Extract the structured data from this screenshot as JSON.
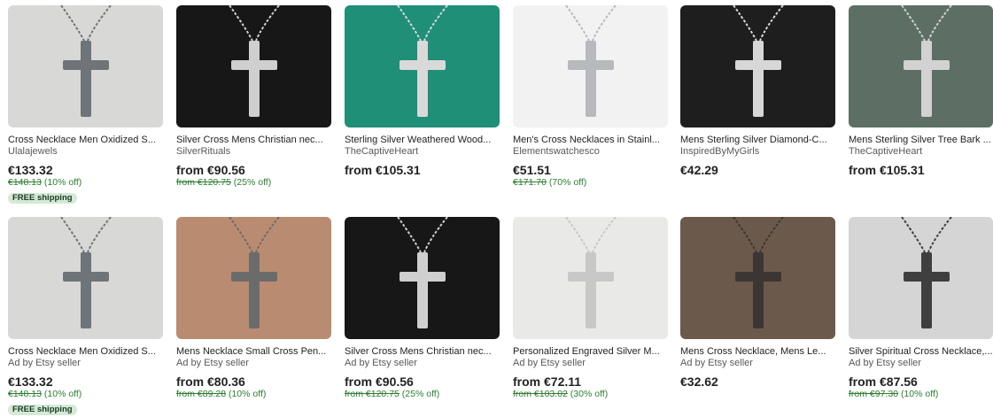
{
  "rows": [
    [
      {
        "title": "Cross Necklace Men Oxidized S...",
        "shop": "Ulalajewels",
        "price": "€133.32",
        "orig": "€148.13",
        "off": "(10% off)",
        "badge": "FREE shipping",
        "colors": {
          "bg": "#d8d8d6",
          "cross": "#6f7479"
        }
      },
      {
        "title": "Silver Cross Mens Christian nec...",
        "shop": "SilverRituals",
        "price": "from €90.56",
        "orig": "from €120.75",
        "off": "(25% off)",
        "badge": "",
        "colors": {
          "bg": "#171717",
          "cross": "#cfcfcf"
        }
      },
      {
        "title": "Sterling Silver Weathered Wood...",
        "shop": "TheCaptiveHeart",
        "price": "from €105.31",
        "orig": "",
        "off": "",
        "badge": "",
        "colors": {
          "bg": "#1f8f78",
          "cross": "#d9d9d9"
        }
      },
      {
        "title": "Men's Cross Necklaces in Stainl...",
        "shop": "Elementswatchesco",
        "price": "€51.51",
        "orig": "€171.70",
        "off": "(70% off)",
        "badge": "",
        "colors": {
          "bg": "#f2f2f2",
          "cross": "#b7b9bc"
        }
      },
      {
        "title": "Mens Sterling Silver Diamond-C...",
        "shop": "InspiredByMyGirls",
        "price": "€42.29",
        "orig": "",
        "off": "",
        "badge": "",
        "colors": {
          "bg": "#1e1e1e",
          "cross": "#d7d7d7"
        }
      },
      {
        "title": "Mens Sterling Silver Tree Bark ...",
        "shop": "TheCaptiveHeart",
        "price": "from €105.31",
        "orig": "",
        "off": "",
        "badge": "",
        "colors": {
          "bg": "#5d6f64",
          "cross": "#d2d2d2"
        }
      }
    ],
    [
      {
        "title": "Cross Necklace Men Oxidized S...",
        "shop": "Ad by Etsy seller",
        "price": "€133.32",
        "orig": "€148.13",
        "off": "(10% off)",
        "badge": "FREE shipping",
        "colors": {
          "bg": "#d8d8d6",
          "cross": "#6f7479"
        }
      },
      {
        "title": "Mens Necklace Small Cross Pen...",
        "shop": "Ad by Etsy seller",
        "price": "from €80.36",
        "orig": "from €89.28",
        "off": "(10% off)",
        "badge": "",
        "colors": {
          "bg": "#b98c72",
          "cross": "#6b6b6b"
        }
      },
      {
        "title": "Silver Cross Mens Christian nec...",
        "shop": "Ad by Etsy seller",
        "price": "from €90.56",
        "orig": "from €120.75",
        "off": "(25% off)",
        "badge": "",
        "colors": {
          "bg": "#171717",
          "cross": "#cfcfcf"
        }
      },
      {
        "title": "Personalized Engraved Silver M...",
        "shop": "Ad by Etsy seller",
        "price": "from €72.11",
        "orig": "from €103.02",
        "off": "(30% off)",
        "badge": "",
        "colors": {
          "bg": "#e9e9e7",
          "cross": "#c8c8c8"
        }
      },
      {
        "title": "Mens Cross Necklace, Mens Le...",
        "shop": "Ad by Etsy seller",
        "price": "€32.62",
        "orig": "",
        "off": "",
        "badge": "",
        "colors": {
          "bg": "#6b5a4b",
          "cross": "#3b3633"
        }
      },
      {
        "title": "Silver Spiritual Cross Necklace,...",
        "shop": "Ad by Etsy seller",
        "price": "from €87.56",
        "orig": "from €97.30",
        "off": "(10% off)",
        "badge": "",
        "colors": {
          "bg": "#d5d5d5",
          "cross": "#3f3f3f"
        }
      }
    ]
  ]
}
